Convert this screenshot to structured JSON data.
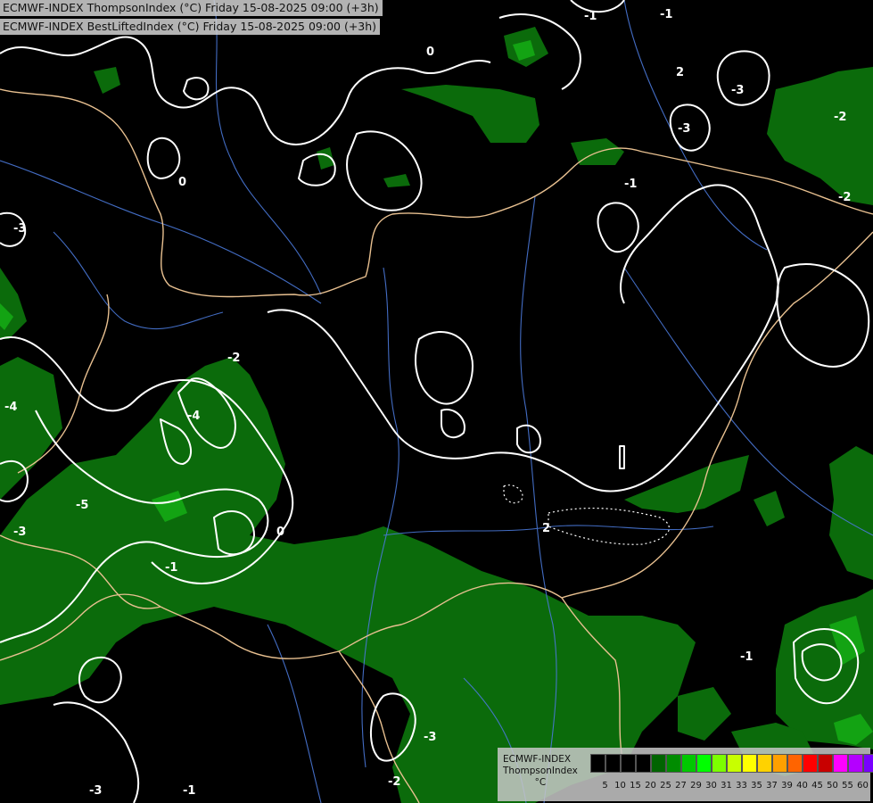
{
  "header": {
    "line1": "ECMWF-INDEX ThompsonIndex (°C) Friday 15-08-2025 09:00 (+3h)",
    "line2": "ECMWF-INDEX BestLiftedIndex (°C) Friday 15-08-2025 09:00 (+3h)"
  },
  "legend": {
    "title_line1": "ECMWF-INDEX",
    "title_line2": "ThompsonIndex",
    "unit": "°C",
    "ticks": [
      "5",
      "10",
      "15",
      "20",
      "25",
      "27",
      "29",
      "30",
      "31",
      "33",
      "35",
      "37",
      "39",
      "40",
      "45",
      "50",
      "55",
      "60"
    ],
    "colors": [
      "#000000",
      "#000000",
      "#000000",
      "#000000",
      "#006400",
      "#008c00",
      "#00c800",
      "#00ff00",
      "#7cff00",
      "#c8ff00",
      "#ffff00",
      "#ffd200",
      "#ffa000",
      "#ff6400",
      "#ff0000",
      "#c80000",
      "#ff00ff",
      "#b400ff",
      "#7800ff",
      "#0000ff"
    ]
  },
  "contour_labels": [
    {
      "text": "-1"
    },
    {
      "text": "0"
    },
    {
      "text": "-3"
    },
    {
      "text": "-2"
    },
    {
      "text": "-4"
    },
    {
      "text": "-5"
    },
    {
      "text": "2"
    },
    {
      "text": "-1"
    },
    {
      "text": "0"
    },
    {
      "text": "-3"
    },
    {
      "text": "-2"
    },
    {
      "text": "-3"
    },
    {
      "text": "-1"
    },
    {
      "text": "-4"
    },
    {
      "text": "-3"
    },
    {
      "text": "-1"
    },
    {
      "text": "0"
    },
    {
      "text": "-2"
    },
    {
      "text": "2"
    },
    {
      "text": "-1"
    },
    {
      "text": "-3"
    },
    {
      "text": "-2"
    },
    {
      "text": "-3"
    },
    {
      "text": "-1"
    }
  ],
  "colors": {
    "background": "#000000",
    "ti_fill": "#0a6a0a",
    "ti_fill_bright": "#12a012",
    "contour": "#ffffff",
    "border": "#e8c090",
    "river": "#4a78d8"
  }
}
